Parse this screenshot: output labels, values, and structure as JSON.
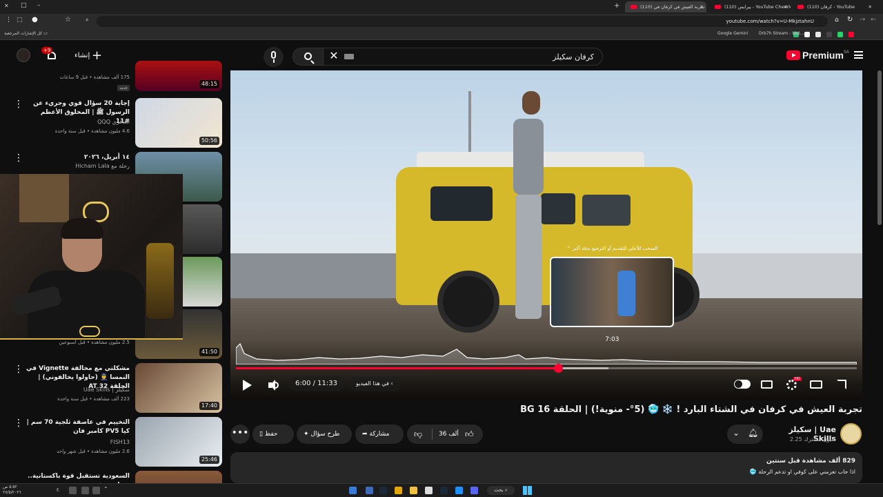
{
  "browser": {
    "tabs": [
      {
        "label": "(110) كرفان - YouTube",
        "active": false
      },
      {
        "label": "(110) بيرابس - YouTube Cheerless l",
        "active": false
      },
      {
        "label": "(110) تجربة العيش في كرفان في",
        "active": true
      }
    ],
    "url": "youtube.com/watch?v=U-MkjztahnU",
    "bookmarks": [
      "Google Gemini",
      "Drb7h Stream - Wat...",
      "كل الإشارات المرجعية"
    ]
  },
  "yt_header": {
    "logo_text": "Premium",
    "region": "SA",
    "search_query": "كرفان سكيلز",
    "create_label": "إنشاء",
    "notif_count": "+9"
  },
  "player": {
    "current_time": "6:00",
    "duration": "11:33",
    "time_display": "6:00 / 11:33",
    "progress_fraction": 0.519,
    "buffer_fraction": 0.6,
    "hover_fraction": 0.606,
    "preview_time": "7:03",
    "preview_hint": "السحب للأعلى للتقديم أو الترجيع بدقة أكبر",
    "chapter_label": "في هذا الفيديو",
    "hd_badge": "HD"
  },
  "video": {
    "title": "تجربة العيش في كرفان في الشتاء البارد ! ❄️ 🥶 (5°- منوية!) | الحلقة 16 BG",
    "channel_name": "سكيلز | Uae Skills",
    "channel_subs": "2.25 مليون مشترك",
    "like_count": "36 ألف",
    "share_label": "مشاركة",
    "ask_label": "طرح سؤال",
    "save_label": "حفظ",
    "more_label": "•••",
    "desc_stats": "829 ألف مشاهدة  قبل سنتين",
    "desc_text": "اذا حاب تعزمني على كوفي او تدعم الرحلة 🥶"
  },
  "sidebar": {
    "items": [
      {
        "title": "",
        "channel": "",
        "meta": "175 ألف مشاهدة • قبل 9 ساعات",
        "badge": "جديد",
        "duration": "48:15"
      },
      {
        "title": "إجابة 20 سؤال قوي وجريء عن الرسول ﷺ | المخلوق الأعظم #11",
        "channel": "الغافري QQQ",
        "meta": "4.6 مليون مشاهدة • قبل سنة واحدة",
        "badge": "",
        "duration": "50:56"
      },
      {
        "title": "١٤ أبريل، ٢٠٢٦",
        "channel": "رحلة مع Hicham Lala",
        "meta": "",
        "badge": "",
        "duration": ""
      },
      {
        "title": "",
        "channel": "",
        "meta": "",
        "badge": "",
        "duration": ""
      },
      {
        "title": "",
        "channel": "",
        "meta": "",
        "badge": "",
        "duration": ""
      },
      {
        "title": "",
        "channel": "",
        "meta": "2.5 مليون مشاهدة • قبل أسبوعين",
        "badge": "",
        "duration": "41:50"
      },
      {
        "title": "مشكلتي مع مخالفة Vignette في النمسا 👮 (حاولوا يخالفوني) | الحلقة 32 AT",
        "channel": "سكيلز | Uae Skills",
        "meta": "223 ألف مشاهدة • قبل سنة واحدة",
        "badge": "",
        "duration": "17:40"
      },
      {
        "title": "التخييم في عاصفة ثلجية 70 سم | كيا PV5 كامبر فان",
        "channel": "FISH13",
        "meta": "2.6 مليون مشاهدة • قبل شهر واحد",
        "badge": "",
        "duration": "25:46"
      },
      {
        "title": "السعودية تستقبل قوة باكستانية.. وترامب يفتح",
        "channel": "",
        "meta": "",
        "badge": "",
        "duration": ""
      }
    ]
  },
  "taskbar": {
    "search_label": "بحث",
    "clock": "٥:٥٢ ص",
    "date": "٢٧/٥/٢٠٢٦",
    "lang": "ع"
  },
  "colors": {
    "accent": "#ff0033",
    "bg": "#0f0f0f",
    "pill": "#272727",
    "stream_gold": "#d9b347"
  }
}
